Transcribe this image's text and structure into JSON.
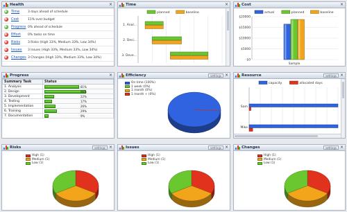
{
  "panels": {
    "health": {
      "title": "Health"
    },
    "time": {
      "title": "Time"
    },
    "cost": {
      "title": "Cost"
    },
    "progress": {
      "title": "Progress"
    },
    "efficiency": {
      "title": "Efficiency",
      "settings_label": "settings"
    },
    "resource": {
      "title": "Resource",
      "settings_label": "settings"
    },
    "risks": {
      "title": "Risks",
      "settings_label": "settings"
    },
    "issues": {
      "title": "Issues",
      "settings_label": "settings"
    },
    "changes": {
      "title": "Changes",
      "settings_label": "settings"
    }
  },
  "health": {
    "rows": [
      {
        "label": "Time",
        "text": "3 days ahead of schedule",
        "status_color": "#3fae2a"
      },
      {
        "label": "Cost",
        "text": "11% over budget",
        "status_color": "#d8281c"
      },
      {
        "label": "Progress",
        "text": "0% ahead of schedule",
        "status_color": "#3fae2a"
      },
      {
        "label": "Effort",
        "text": "0% tasks on time",
        "status_color": "#d8281c"
      },
      {
        "label": "Risks",
        "text": "3 Risks (High 33%, Medium 33%, Low 34%)",
        "status_color": "#d8281c"
      },
      {
        "label": "Issues",
        "text": "3 Issues (High 33%, Medium 33%, Low 34%)",
        "status_color": "#d8281c"
      },
      {
        "label": "Changes",
        "text": "3 Changes (High 33%, Medium 33%, Low 34%)",
        "status_color": "#d8281c"
      }
    ]
  },
  "progress": {
    "headers": [
      "Summary Task",
      "Status"
    ],
    "rows": [
      {
        "task": "1. Analysis",
        "label": "81%",
        "value": 81
      },
      {
        "task": "2. Design",
        "label": "96%",
        "value": 96
      },
      {
        "task": "3. Development",
        "label": "22%",
        "value": 22
      },
      {
        "task": "4. Testing",
        "label": "17%",
        "value": 17
      },
      {
        "task": "5. Implementation",
        "label": "26%",
        "value": 26
      },
      {
        "task": "6. Training",
        "label": "29%",
        "value": 29
      },
      {
        "task": "7. Documentation",
        "label": "9%",
        "value": 9
      }
    ]
  },
  "icons": {
    "panel": "chart-icon",
    "close": "close-icon",
    "status": "status-dot-icon"
  },
  "colors": {
    "green": "#6ac72f",
    "orange": "#f2a51a",
    "red": "#e0321d",
    "blue": "#2f63e0",
    "header": "#1d2f4d"
  },
  "chart_data": [
    {
      "id": "time",
      "type": "bar",
      "orientation": "horizontal",
      "categories": [
        "1. Anal...",
        "2. Desi...",
        "3. Deve..."
      ],
      "series": [
        {
          "name": "planned",
          "color": "#6ac72f",
          "values": [
            [
              0.5,
              1.8
            ],
            [
              1.0,
              3.1
            ],
            [
              2.3,
              5.0
            ]
          ]
        },
        {
          "name": "baseline",
          "color": "#f2a51a",
          "values": [
            [
              0.5,
              1.8
            ],
            [
              1.0,
              3.1
            ],
            [
              2.3,
              5.0
            ]
          ]
        }
      ],
      "legend": "top"
    },
    {
      "id": "cost",
      "type": "bar",
      "categories": [
        "Sample"
      ],
      "series": [
        {
          "name": "actual",
          "color": "#2f63e0",
          "values": [
            16500
          ]
        },
        {
          "name": "planned",
          "color": "#6ac72f",
          "values": [
            18700
          ]
        },
        {
          "name": "baseline",
          "color": "#f2a51a",
          "values": [
            18700
          ]
        }
      ],
      "yticks": [
        "$0",
        "$5000",
        "$10000",
        "$15000",
        "$20000"
      ],
      "ylim": [
        0,
        20000
      ],
      "legend": "top"
    },
    {
      "id": "efficiency",
      "type": "pie",
      "labels": [
        "On time (100%)",
        "1 week (0%)",
        "1 month (0%)",
        "1 month + (0%)"
      ],
      "values": [
        100,
        0,
        0,
        0
      ],
      "colors": [
        "#2f63e0",
        "#6ac72f",
        "#f2a51a",
        "#e0321d"
      ]
    },
    {
      "id": "resource",
      "type": "bar",
      "orientation": "horizontal",
      "categories": [
        "Sam",
        "Mike"
      ],
      "series": [
        {
          "name": "capacity",
          "color": "#2f63e0",
          "values": [
            100,
            100
          ]
        },
        {
          "name": "allocated days",
          "color": "#e0321d",
          "values": [
            2,
            4
          ]
        }
      ],
      "legend": "top"
    },
    {
      "id": "risks",
      "type": "pie",
      "labels": [
        "High (1)",
        "Medium (1)",
        "Low (1)"
      ],
      "values": [
        1,
        1,
        1
      ],
      "colors": [
        "#e0321d",
        "#f2a51a",
        "#6ac72f"
      ]
    },
    {
      "id": "issues",
      "type": "pie",
      "labels": [
        "High (1)",
        "Medium (1)",
        "Low (1)"
      ],
      "values": [
        1,
        1,
        1
      ],
      "colors": [
        "#e0321d",
        "#f2a51a",
        "#6ac72f"
      ]
    },
    {
      "id": "changes",
      "type": "pie",
      "labels": [
        "High (1)",
        "Medium (1)",
        "Low (1)"
      ],
      "values": [
        1,
        1,
        1
      ],
      "colors": [
        "#e0321d",
        "#f2a51a",
        "#6ac72f"
      ]
    }
  ]
}
